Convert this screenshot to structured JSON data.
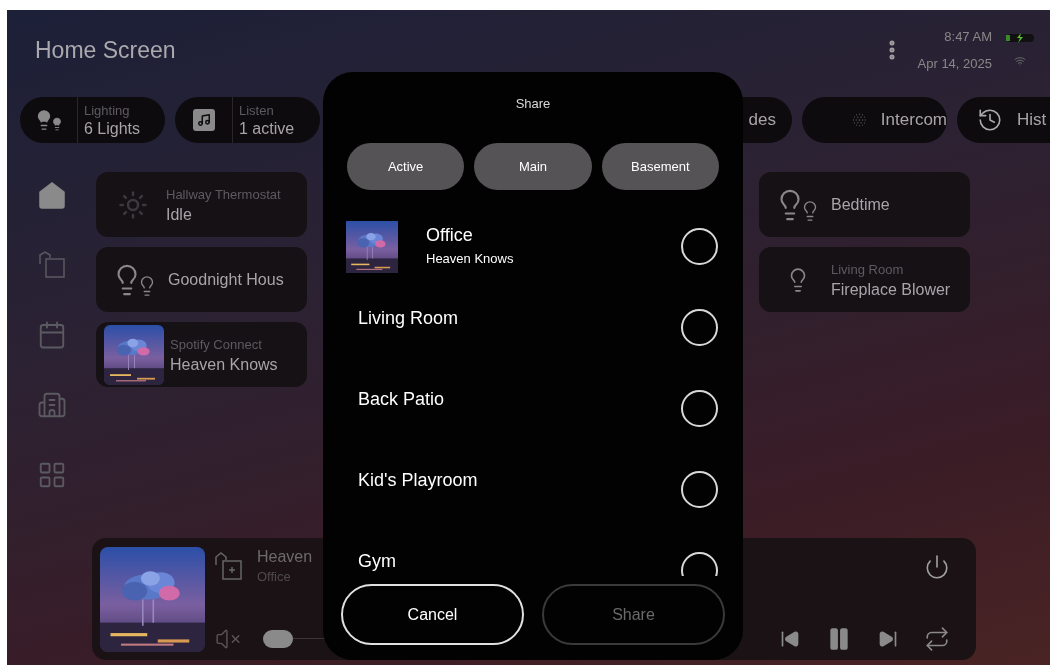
{
  "header": {
    "title": "Home Screen",
    "time": "8:47 AM",
    "date": "Apr 14, 2025"
  },
  "pills": [
    {
      "kind": "lighting",
      "label": "Lighting",
      "value": "6 Lights"
    },
    {
      "kind": "listen",
      "label": "Listen",
      "value": "1 active"
    },
    {
      "kind": "shades",
      "name": "des"
    },
    {
      "kind": "intercom",
      "name": "Intercom"
    },
    {
      "kind": "history",
      "name": "Hist"
    }
  ],
  "sidebar": {
    "items": [
      {
        "kind": "home",
        "selected": true
      },
      {
        "kind": "rooms",
        "selected": false
      },
      {
        "kind": "schedule",
        "selected": false
      },
      {
        "kind": "building",
        "selected": false
      },
      {
        "kind": "apps",
        "selected": false
      }
    ]
  },
  "card_rows": [
    {
      "left": {
        "kind": "thermostat",
        "label": "Hallway Thermostat",
        "value": "Idle"
      },
      "right": {
        "kind": "scene",
        "name": "Bedtime"
      }
    },
    {
      "left": {
        "kind": "scene",
        "name": "Goodnight Hous"
      },
      "right": {
        "kind": "light",
        "label": "Living Room",
        "value": "Fireplace Blower"
      }
    },
    {
      "left": {
        "kind": "media",
        "label": "Spotify Connect",
        "value": "Heaven Knows"
      }
    }
  ],
  "player": {
    "title": "Heaven",
    "room": "Office",
    "volume": {
      "muted": true,
      "level": 0
    }
  },
  "share_dialog": {
    "title": "Share",
    "tabs": [
      {
        "label": "Active",
        "selected": false
      },
      {
        "label": "Main",
        "selected": false
      },
      {
        "label": "Basement",
        "selected": false
      }
    ],
    "zones": [
      {
        "name": "Office",
        "subtitle": "Heaven Knows",
        "kind": "playing",
        "checked": false
      },
      {
        "name": "Living Room",
        "kind": "plain",
        "checked": false
      },
      {
        "name": "Back Patio",
        "kind": "plain",
        "checked": false
      },
      {
        "name": "Kid's Playroom",
        "kind": "plain",
        "checked": false
      },
      {
        "name": "Gym",
        "kind": "plain",
        "checked": false
      }
    ],
    "buttons": [
      {
        "label": "Cancel",
        "disabled": false
      },
      {
        "label": "Share",
        "disabled": true
      }
    ]
  }
}
